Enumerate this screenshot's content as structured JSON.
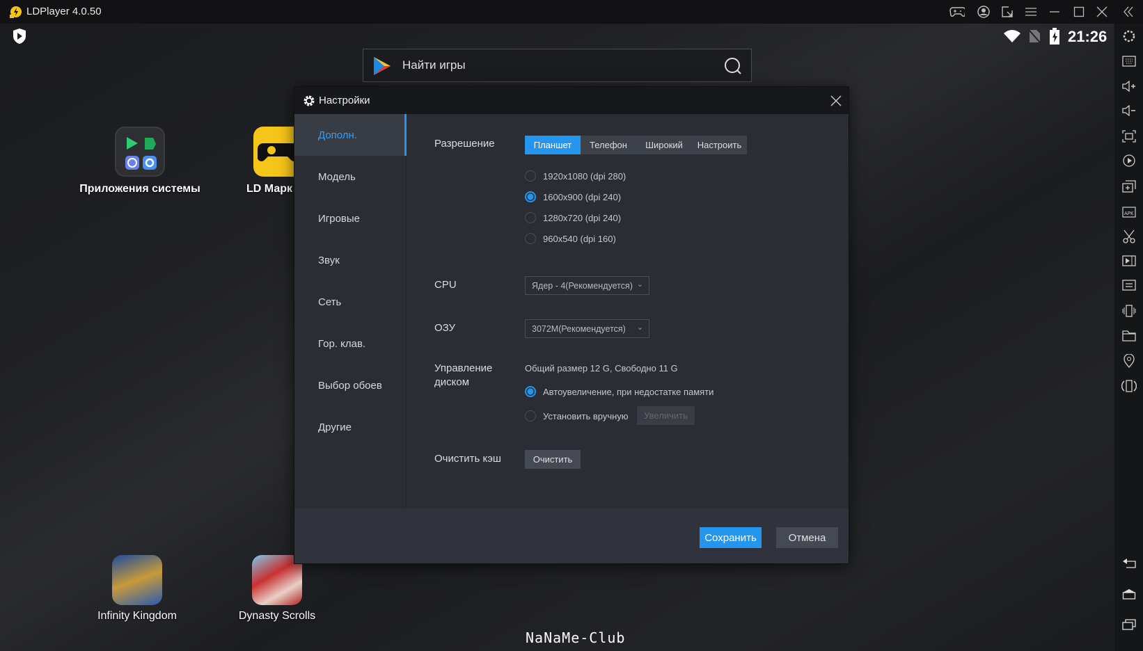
{
  "window": {
    "title": "LDPlayer 4.0.50",
    "brand_color": "#f5c518",
    "controls": [
      "gamepad-icon",
      "account-icon",
      "resize-icon",
      "menu-icon",
      "minimize-icon",
      "maximize-icon",
      "close-icon",
      "collapse-icon"
    ]
  },
  "status": {
    "time": "21:26",
    "icons": [
      "wifi-icon",
      "no-sim-icon",
      "battery-charging-icon"
    ]
  },
  "search": {
    "placeholder": "Найти игры"
  },
  "desktop": {
    "apps": [
      {
        "label": "Приложения системы"
      },
      {
        "label": "LD Марк"
      },
      {
        "label": "Infinity Kingdom"
      },
      {
        "label": "Dynasty Scrolls"
      }
    ],
    "watermark": "NaNaMe-Club"
  },
  "toolbar": [
    "settings",
    "keyboard",
    "volume-up",
    "volume-down",
    "fullscreen",
    "record",
    "multi-instance",
    "apk-install",
    "screenshot",
    "video",
    "sync",
    "shake",
    "folder",
    "location",
    "rotate"
  ],
  "toolbar_bottom": [
    "back",
    "home",
    "recent"
  ],
  "dialog": {
    "title": "Настройки",
    "sidebar": [
      {
        "label": "Дополн.",
        "selected": true
      },
      {
        "label": "Модель"
      },
      {
        "label": "Игровые"
      },
      {
        "label": "Звук"
      },
      {
        "label": "Сеть"
      },
      {
        "label": "Гор. клав."
      },
      {
        "label": "Выбор обоев"
      },
      {
        "label": "Другие"
      }
    ],
    "resolution": {
      "label": "Разрешение",
      "tabs": [
        "Планшет",
        "Телефон",
        "Широкий",
        "Настроить"
      ],
      "active_tab": "Планшет",
      "options": [
        {
          "label": "1920x1080  (dpi 280)",
          "checked": false
        },
        {
          "label": "1600x900  (dpi 240)",
          "checked": true
        },
        {
          "label": "1280x720  (dpi 240)",
          "checked": false
        },
        {
          "label": "960x540  (dpi 160)",
          "checked": false
        }
      ]
    },
    "cpu": {
      "label": "CPU",
      "value": "Ядер - 4(Рекомендуется)"
    },
    "ram": {
      "label": "ОЗУ",
      "value": "3072M(Рекомендуется)"
    },
    "disk": {
      "label_line1": "Управление",
      "label_line2": "диском",
      "info": "Общий размер 12 G,  Свободно 11 G",
      "auto": "Автоувеличение, при недостатке памяти",
      "auto_checked": true,
      "manual": "Установить вручную",
      "manual_checked": false,
      "increase": "Увеличить"
    },
    "cache": {
      "label": "Очистить кэш",
      "button": "Очистить"
    },
    "save": "Сохранить",
    "cancel": "Отмена",
    "accent": "#2596f0"
  }
}
